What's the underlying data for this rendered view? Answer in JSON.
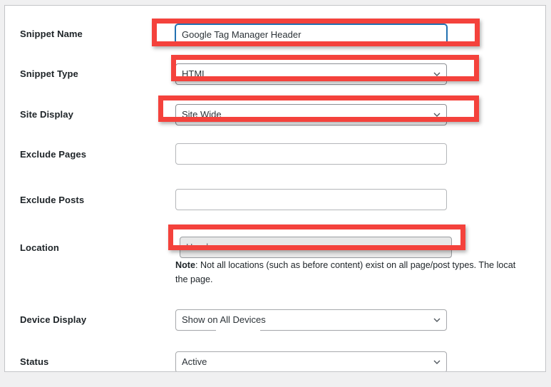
{
  "page": {
    "background_color": "#f0f0f1",
    "card_background": "#ffffff",
    "highlight_color": "#f4423c",
    "focus_color": "#2271b1"
  },
  "form": {
    "fields": [
      {
        "id": "snippet-name",
        "label": "Snippet Name",
        "type": "text",
        "value": "Google Tag Manager Header",
        "placeholder": "",
        "focused": true,
        "highlighted": true
      },
      {
        "id": "snippet-type",
        "label": "Snippet Type",
        "type": "select",
        "value": "HTML",
        "highlighted": true
      },
      {
        "id": "site-display",
        "label": "Site Display",
        "type": "select",
        "value": "Site Wide",
        "highlighted": true
      },
      {
        "id": "exclude-pages",
        "label": "Exclude Pages",
        "type": "text",
        "value": "",
        "placeholder": "",
        "highlighted": false
      },
      {
        "id": "exclude-posts",
        "label": "Exclude Posts",
        "type": "text",
        "value": "",
        "placeholder": "",
        "highlighted": false
      },
      {
        "id": "location",
        "label": "Location",
        "type": "select",
        "value": "Header",
        "disabled": true,
        "highlighted": true
      },
      {
        "id": "device-display",
        "label": "Device Display",
        "type": "select",
        "value": "Show on All Devices",
        "highlighted": false
      },
      {
        "id": "status",
        "label": "Status",
        "type": "select",
        "value": "Active",
        "highlighted": false
      }
    ],
    "location_note": {
      "prefix": "Note",
      "line1": ": Not all locations (such as before content) exist on all page/post types. The locat",
      "line2": "the page."
    }
  },
  "icons": {
    "chevron": "chevron-down-icon"
  }
}
